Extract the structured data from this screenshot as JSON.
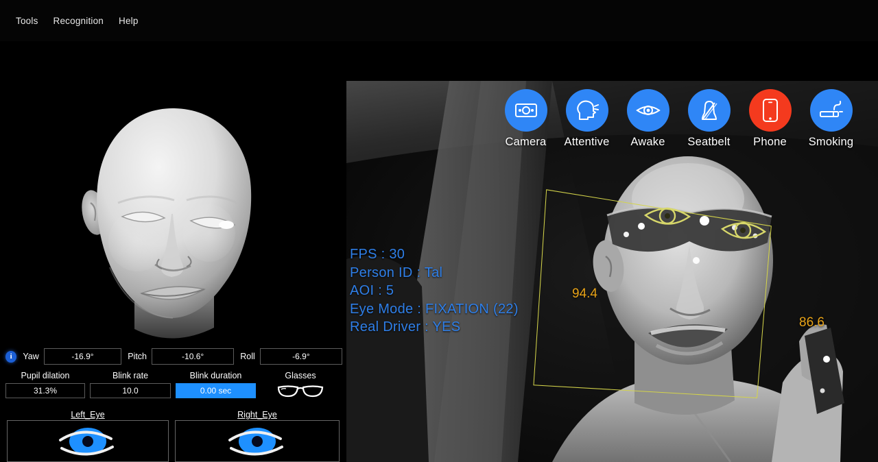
{
  "menubar": {
    "items": [
      {
        "label": "Tools",
        "name": "menu-tools"
      },
      {
        "label": "Recognition",
        "name": "menu-recognition"
      },
      {
        "label": "Help",
        "name": "menu-help"
      }
    ]
  },
  "left_panel": {
    "head_model": {
      "name": "head-pose-3d-model",
      "description": "3D head model"
    },
    "info_icon": "i",
    "pose": [
      {
        "label": "Yaw",
        "value": "-16.9°"
      },
      {
        "label": "Pitch",
        "value": "-10.6°"
      },
      {
        "label": "Roll",
        "value": "-6.9°"
      }
    ],
    "metrics": [
      {
        "label": "Pupil dilation",
        "value": "31.3%",
        "highlight": false
      },
      {
        "label": "Blink rate",
        "value": "10.0",
        "highlight": false
      },
      {
        "label": "Blink duration",
        "value": "0.00 sec",
        "highlight": true
      }
    ],
    "glasses": {
      "label": "Glasses",
      "icon": "sunglasses-icon"
    },
    "eyes": [
      {
        "label": "Left_Eye",
        "icon": "eye-icon"
      },
      {
        "label": "Right_Eye",
        "icon": "eye-icon"
      }
    ]
  },
  "video_panel": {
    "status_indicators": [
      {
        "label": "Camera",
        "icon": "camera-icon",
        "state_color": "#2f86f6"
      },
      {
        "label": "Attentive",
        "icon": "head-profile-icon",
        "state_color": "#2f86f6"
      },
      {
        "label": "Awake",
        "icon": "eye-icon",
        "state_color": "#2f86f6"
      },
      {
        "label": "Seatbelt",
        "icon": "seatbelt-icon",
        "state_color": "#2f86f6"
      },
      {
        "label": "Phone",
        "icon": "phone-icon",
        "state_color": "#f43a1e"
      },
      {
        "label": "Smoking",
        "icon": "cigarette-icon",
        "state_color": "#2f86f6"
      }
    ],
    "telemetry": [
      "FPS : 30",
      "Person ID : Tal",
      "AOI : 5",
      "Eye Mode : FIXATION (22)",
      "Real Driver : YES"
    ],
    "detection": {
      "confidence_left": "94.4",
      "confidence_right": "86.6",
      "box_color": "#d4d44a"
    }
  },
  "colors": {
    "accent_blue": "#2f86f6",
    "alert_red": "#f43a1e",
    "highlight_blue": "#1e90ff",
    "telemetry_blue": "#2f7fe8",
    "confidence_orange": "#e8a317",
    "box_yellow": "#d4d44a"
  }
}
